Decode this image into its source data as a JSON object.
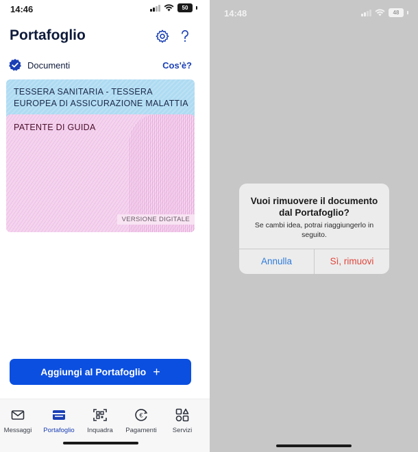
{
  "left": {
    "status": {
      "time": "14:46",
      "battery": "50"
    },
    "title": "Portafoglio",
    "section": {
      "label": "Documenti",
      "link": "Cos'è?"
    },
    "cards": [
      {
        "title": "TESSERA SANITARIA - TESSERA EUROPEA DI ASSICURAZIONE MALATTIA",
        "color": "#aedbf2"
      },
      {
        "title": "PATENTE DI GUIDA",
        "badge": "VERSIONE DIGITALE",
        "color": "#f4d4ee"
      }
    ],
    "add_button": "Aggiungi al Portafoglio",
    "tabs": [
      {
        "label": "Messaggi",
        "icon": "envelope-icon"
      },
      {
        "label": "Portafoglio",
        "icon": "wallet-icon",
        "active": true
      },
      {
        "label": "Inquadra",
        "icon": "qr-scan-icon"
      },
      {
        "label": "Pagamenti",
        "icon": "euro-icon"
      },
      {
        "label": "Servizi",
        "icon": "grid-icon"
      }
    ],
    "accent": "#0b4fe0"
  },
  "right": {
    "status": {
      "time": "14:48",
      "battery": "48"
    },
    "dialog": {
      "title": "Vuoi rimuovere il documento dal Portafoglio?",
      "message": "Se cambi idea, potrai riaggiungerlo in seguito.",
      "cancel": "Annulla",
      "confirm": "Sì, rimuovi"
    }
  }
}
